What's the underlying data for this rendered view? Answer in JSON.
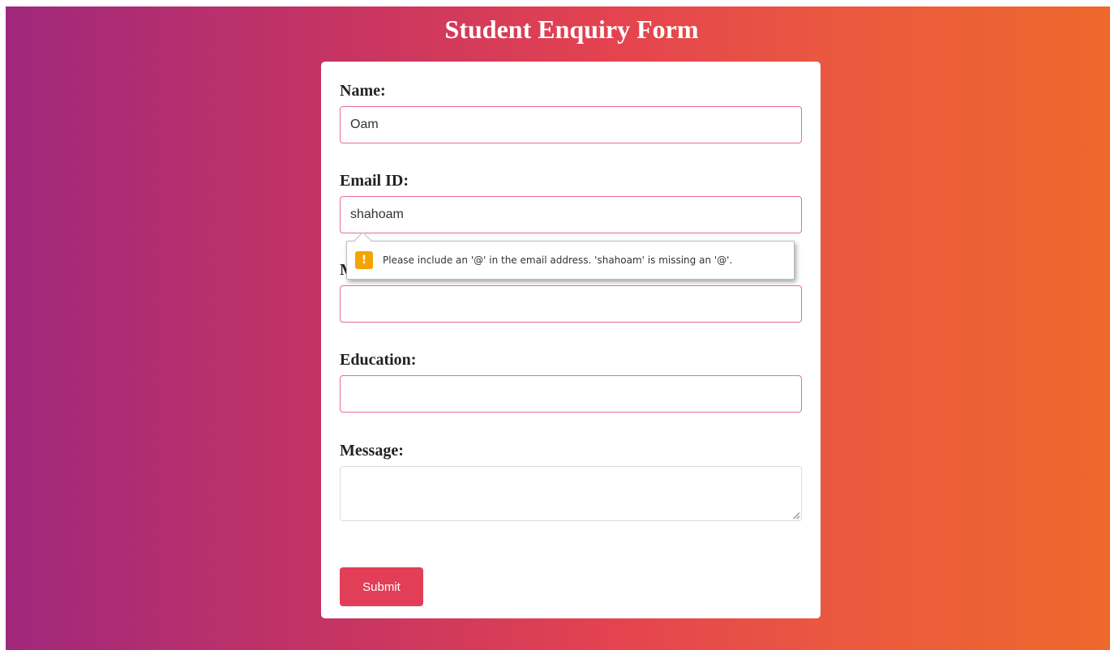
{
  "page": {
    "title": "Student Enquiry Form"
  },
  "form": {
    "name": {
      "label": "Name:",
      "value": "Oam"
    },
    "email": {
      "label": "Email ID:",
      "value": "shahoam"
    },
    "mobile": {
      "label": "M",
      "value": ""
    },
    "education": {
      "label": "Education:",
      "value": ""
    },
    "message": {
      "label": "Message:",
      "value": ""
    },
    "submit_label": "Submit"
  },
  "validation_tooltip": {
    "icon": "warning-icon",
    "icon_glyph": "!",
    "text": "Please include an '@' in the email address. 'shahoam' is missing an '@'."
  },
  "colors": {
    "gradient_start": "#a0287c",
    "gradient_end": "#ef682c",
    "submit_button": "#e23e57",
    "input_border": "#e66f8a",
    "warning": "#f5a300"
  }
}
